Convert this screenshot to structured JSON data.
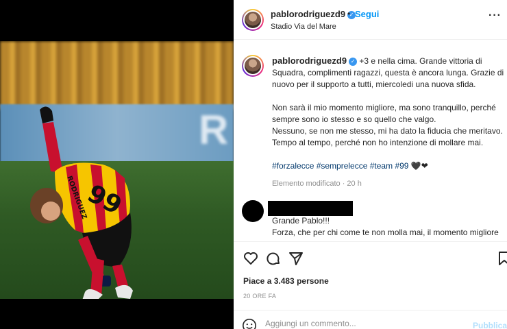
{
  "header": {
    "username": "pablorodriguezd9",
    "separator": "•",
    "follow_label": "Segui",
    "location": "Stadio Via del Mare",
    "more_icon": "ellipsis-icon"
  },
  "photo": {
    "board_letters": "R",
    "jersey_number": "99",
    "jersey_name": "RODRIGUEZ"
  },
  "caption": {
    "username": "pablorodriguezd9",
    "line1": "+3 e nella cima. Grande vittoria di Squadra, complimenti ragazzi, questa è ancora lunga. Grazie di nuovo per il supporto a tutti, miercoledi una nuova sfida.",
    "line2": "Non sarà il mio momento migliore, ma sono tranquillo, perché sempre sono io stesso e so quello che valgo.",
    "line3": "Nessuno, se non me stesso, mi ha dato la fiducia che meritavo.",
    "line4": "Tempo al tempo, perché non ho intenzione di mollare mai.",
    "hashtags": "#forzalecce #semprelecce #team #99",
    "hearts": "🖤❤",
    "edited": "Elemento modificato · 20 h"
  },
  "comment": {
    "line1": "Grande Pablo!!!",
    "line2": "Forza, che per chi come te non molla mai, il momento migliore"
  },
  "actions": {
    "like_icon": "heart-icon",
    "comment_icon": "comment-icon",
    "share_icon": "send-icon",
    "save_icon": "bookmark-icon"
  },
  "likes": "Piace a 3.483 persone",
  "timestamp": "20 ORE FA",
  "add_comment": {
    "placeholder": "Aggiungi un commento...",
    "publish_label": "Pubblica",
    "emoji_icon": "emoji-icon"
  },
  "colors": {
    "accent": "#0095f6",
    "hashtag": "#00376b",
    "jersey_red": "#c8102e",
    "jersey_yellow": "#f6c500"
  }
}
